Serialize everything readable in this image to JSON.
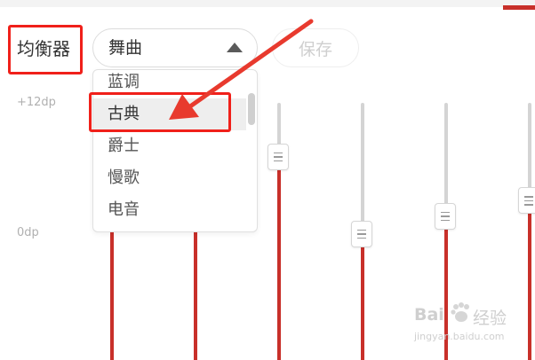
{
  "equalizer": {
    "title": "均衡器",
    "preset_selected": "舞曲",
    "save_label": "保存",
    "db_labels": {
      "max": "+12dp",
      "mid": "0dp"
    },
    "bands": [
      {
        "level": 1.0
      },
      {
        "level": 1.0
      },
      {
        "level": 0.79
      },
      {
        "level": 0.49
      },
      {
        "level": 0.56
      },
      {
        "level": 0.62
      }
    ]
  },
  "dropdown": {
    "options": [
      "蓝调",
      "古典",
      "爵士",
      "慢歌",
      "电音"
    ],
    "highlighted": "古典"
  },
  "annotations": {
    "box_color": "#f0201a",
    "arrow_color": "#e83a2e"
  },
  "watermark": {
    "brand": "Bai",
    "product": "经验",
    "url": "jingyan.baidu.com"
  },
  "colors": {
    "accent": "#c8302a",
    "track": "#d4d4d4"
  }
}
